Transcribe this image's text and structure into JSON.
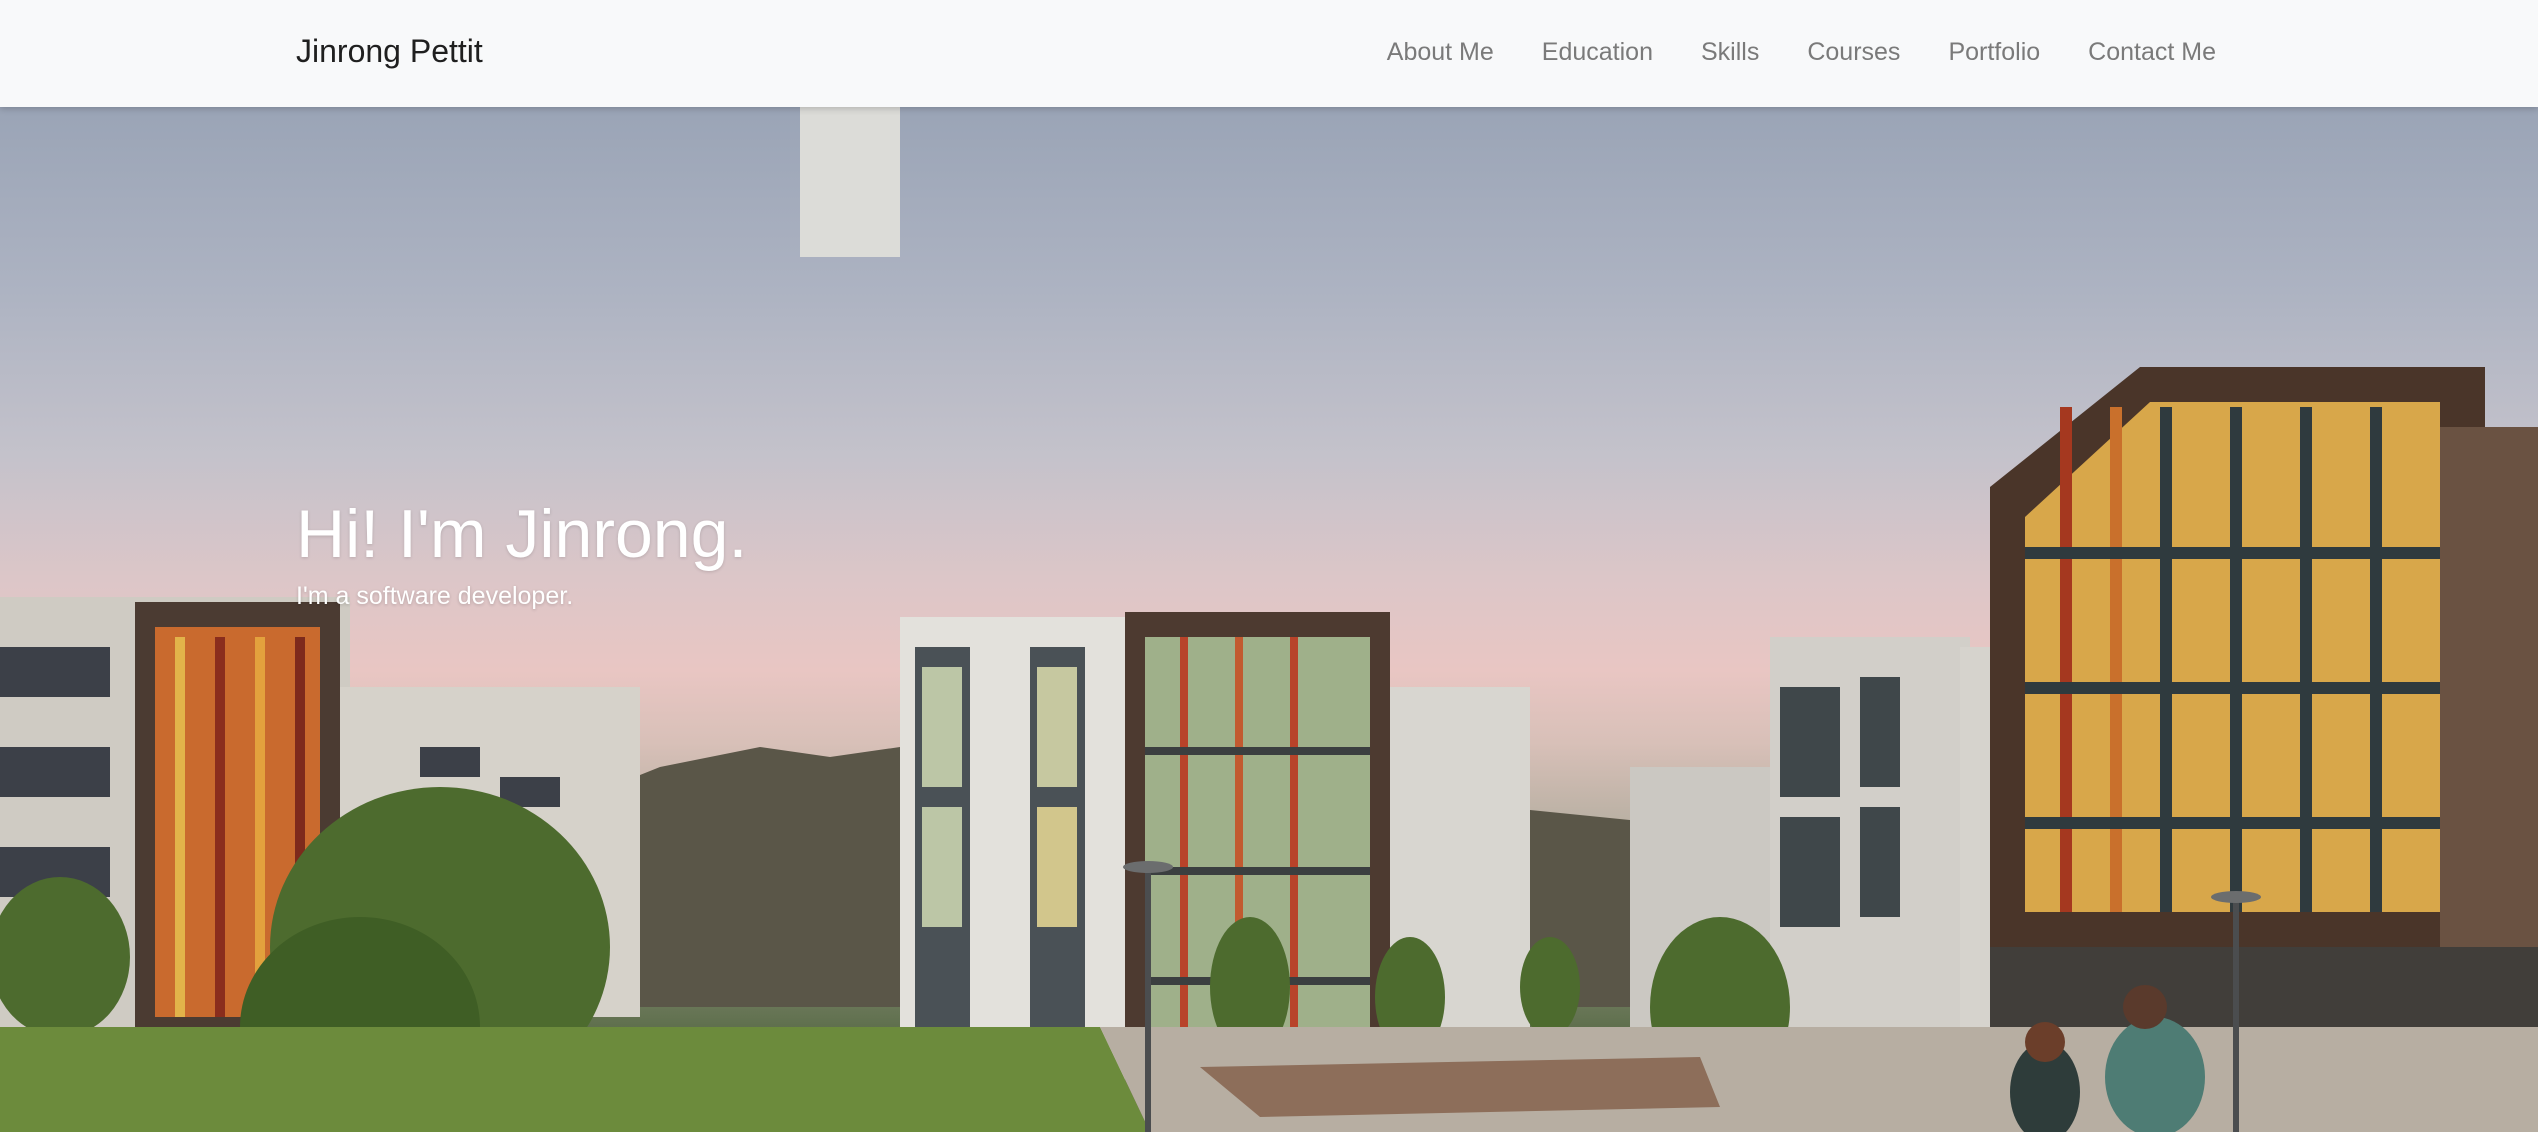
{
  "navbar": {
    "brand": "Jinrong Pettit",
    "links": [
      {
        "label": "About Me"
      },
      {
        "label": "Education"
      },
      {
        "label": "Skills"
      },
      {
        "label": "Courses"
      },
      {
        "label": "Portfolio"
      },
      {
        "label": "Contact Me"
      }
    ]
  },
  "hero": {
    "title": "Hi! I'm Jinrong.",
    "subtitle": "I'm a software developer.",
    "background_image": "campus-buildings-photo"
  },
  "colors": {
    "navbar_bg": "#f8f9fa",
    "brand_text": "#1f1f1f",
    "nav_link_text": "#7a7a7a",
    "hero_text": "#ffffff"
  }
}
